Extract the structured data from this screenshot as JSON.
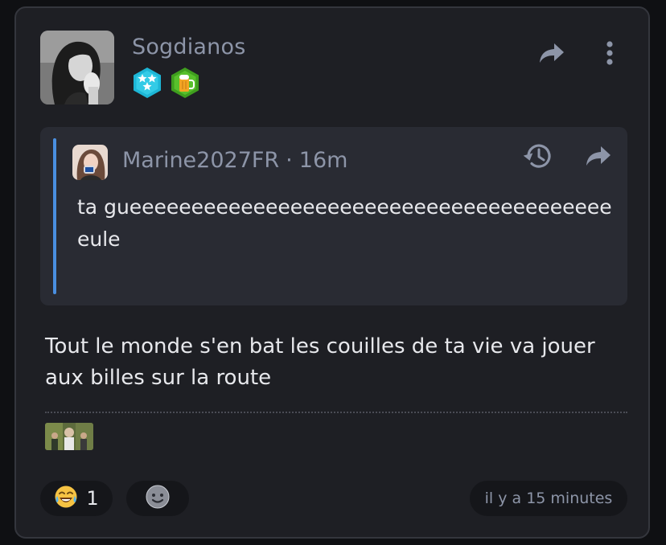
{
  "post": {
    "username": "Sogdianos",
    "badges": [
      "stars-badge-icon",
      "beer-badge-icon"
    ],
    "quote": {
      "author": "Marine2027FR",
      "separator": "·",
      "time": "16m",
      "text": "ta gueeeeeeeeeeeeeeeeeeeeeeeeeeeeeeeeeeeeeeeeule"
    },
    "body": "Tout le monde s'en bat les couilles de ta vie va jouer aux billes sur la route",
    "reactions": [
      {
        "icon": "laughing-crying-emoji-icon",
        "count": "1"
      }
    ],
    "timestamp": "il y a 15 minutes"
  },
  "colors": {
    "card_bg": "#1e1f24",
    "quote_bg": "#292b33",
    "quote_accent": "#4a8fe0",
    "muted_text": "#8d95a8",
    "text": "#e7e8ec"
  }
}
